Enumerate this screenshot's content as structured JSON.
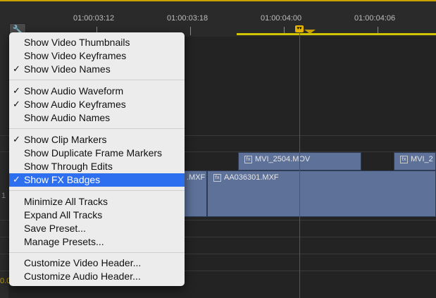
{
  "timeline": {
    "timecodes": [
      "01:00:03:12",
      "01:00:03:18",
      "01:00:04:00",
      "01:00:04:06"
    ],
    "clips": {
      "v_clip_1": "MVI_2504.MOV",
      "v_clip_2": "MVI_2",
      "a_clip_left": ".MXF",
      "a_clip_main": "AA036301.MXF"
    },
    "fx_badge": "fx",
    "left_fragments": [
      "1",
      "0.0"
    ],
    "accent": "#c8a000",
    "clip_color": "#5d7199",
    "playhead_color": "#d02020"
  },
  "menu": {
    "items": [
      {
        "label": "Show Video Thumbnails",
        "checked": false
      },
      {
        "label": "Show Video Keyframes",
        "checked": false
      },
      {
        "label": "Show Video Names",
        "checked": true
      },
      {
        "label": "Show Audio Waveform",
        "checked": true
      },
      {
        "label": "Show Audio Keyframes",
        "checked": true
      },
      {
        "label": "Show Audio Names",
        "checked": false
      },
      {
        "label": "Show Clip Markers",
        "checked": true
      },
      {
        "label": "Show Duplicate Frame Markers",
        "checked": false
      },
      {
        "label": "Show Through Edits",
        "checked": false
      },
      {
        "label": "Show FX Badges",
        "checked": true,
        "highlighted": true
      },
      {
        "label": "Minimize All Tracks",
        "checked": false
      },
      {
        "label": "Expand All Tracks",
        "checked": false
      },
      {
        "label": "Save Preset...",
        "checked": false
      },
      {
        "label": "Manage Presets...",
        "checked": false
      },
      {
        "label": "Customize Video Header...",
        "checked": false
      },
      {
        "label": "Customize Audio Header...",
        "checked": false
      }
    ],
    "check_glyph": "✓",
    "highlight_color": "#2e6ff0"
  }
}
